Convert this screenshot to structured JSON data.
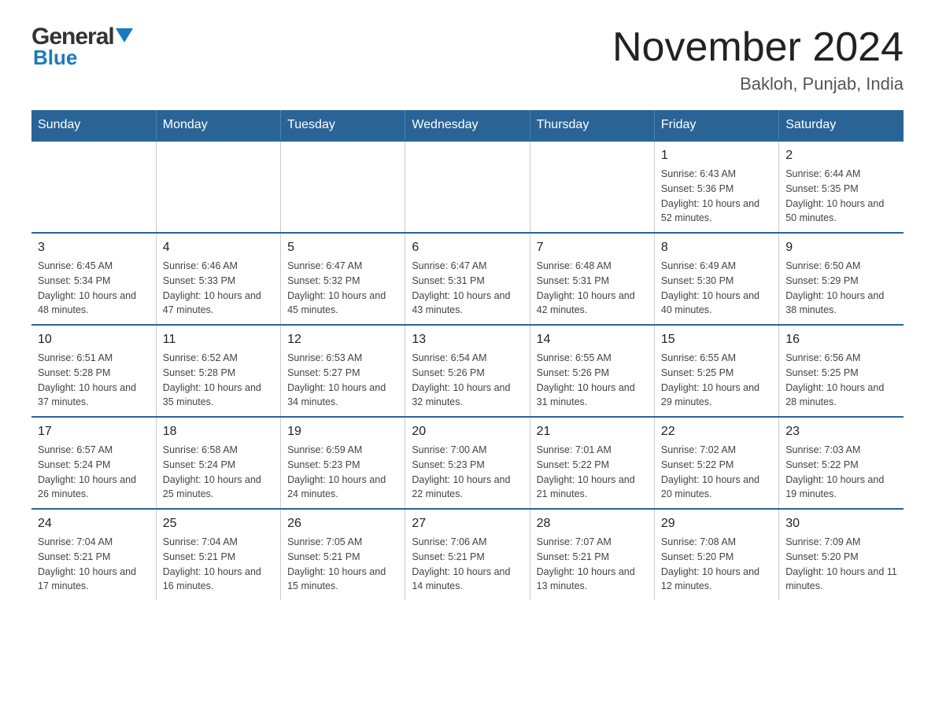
{
  "header": {
    "logo_general": "General",
    "logo_blue": "Blue",
    "title": "November 2024",
    "subtitle": "Bakloh, Punjab, India"
  },
  "calendar": {
    "weekdays": [
      "Sunday",
      "Monday",
      "Tuesday",
      "Wednesday",
      "Thursday",
      "Friday",
      "Saturday"
    ],
    "weeks": [
      [
        {
          "day": "",
          "info": ""
        },
        {
          "day": "",
          "info": ""
        },
        {
          "day": "",
          "info": ""
        },
        {
          "day": "",
          "info": ""
        },
        {
          "day": "",
          "info": ""
        },
        {
          "day": "1",
          "info": "Sunrise: 6:43 AM\nSunset: 5:36 PM\nDaylight: 10 hours and 52 minutes."
        },
        {
          "day": "2",
          "info": "Sunrise: 6:44 AM\nSunset: 5:35 PM\nDaylight: 10 hours and 50 minutes."
        }
      ],
      [
        {
          "day": "3",
          "info": "Sunrise: 6:45 AM\nSunset: 5:34 PM\nDaylight: 10 hours and 48 minutes."
        },
        {
          "day": "4",
          "info": "Sunrise: 6:46 AM\nSunset: 5:33 PM\nDaylight: 10 hours and 47 minutes."
        },
        {
          "day": "5",
          "info": "Sunrise: 6:47 AM\nSunset: 5:32 PM\nDaylight: 10 hours and 45 minutes."
        },
        {
          "day": "6",
          "info": "Sunrise: 6:47 AM\nSunset: 5:31 PM\nDaylight: 10 hours and 43 minutes."
        },
        {
          "day": "7",
          "info": "Sunrise: 6:48 AM\nSunset: 5:31 PM\nDaylight: 10 hours and 42 minutes."
        },
        {
          "day": "8",
          "info": "Sunrise: 6:49 AM\nSunset: 5:30 PM\nDaylight: 10 hours and 40 minutes."
        },
        {
          "day": "9",
          "info": "Sunrise: 6:50 AM\nSunset: 5:29 PM\nDaylight: 10 hours and 38 minutes."
        }
      ],
      [
        {
          "day": "10",
          "info": "Sunrise: 6:51 AM\nSunset: 5:28 PM\nDaylight: 10 hours and 37 minutes."
        },
        {
          "day": "11",
          "info": "Sunrise: 6:52 AM\nSunset: 5:28 PM\nDaylight: 10 hours and 35 minutes."
        },
        {
          "day": "12",
          "info": "Sunrise: 6:53 AM\nSunset: 5:27 PM\nDaylight: 10 hours and 34 minutes."
        },
        {
          "day": "13",
          "info": "Sunrise: 6:54 AM\nSunset: 5:26 PM\nDaylight: 10 hours and 32 minutes."
        },
        {
          "day": "14",
          "info": "Sunrise: 6:55 AM\nSunset: 5:26 PM\nDaylight: 10 hours and 31 minutes."
        },
        {
          "day": "15",
          "info": "Sunrise: 6:55 AM\nSunset: 5:25 PM\nDaylight: 10 hours and 29 minutes."
        },
        {
          "day": "16",
          "info": "Sunrise: 6:56 AM\nSunset: 5:25 PM\nDaylight: 10 hours and 28 minutes."
        }
      ],
      [
        {
          "day": "17",
          "info": "Sunrise: 6:57 AM\nSunset: 5:24 PM\nDaylight: 10 hours and 26 minutes."
        },
        {
          "day": "18",
          "info": "Sunrise: 6:58 AM\nSunset: 5:24 PM\nDaylight: 10 hours and 25 minutes."
        },
        {
          "day": "19",
          "info": "Sunrise: 6:59 AM\nSunset: 5:23 PM\nDaylight: 10 hours and 24 minutes."
        },
        {
          "day": "20",
          "info": "Sunrise: 7:00 AM\nSunset: 5:23 PM\nDaylight: 10 hours and 22 minutes."
        },
        {
          "day": "21",
          "info": "Sunrise: 7:01 AM\nSunset: 5:22 PM\nDaylight: 10 hours and 21 minutes."
        },
        {
          "day": "22",
          "info": "Sunrise: 7:02 AM\nSunset: 5:22 PM\nDaylight: 10 hours and 20 minutes."
        },
        {
          "day": "23",
          "info": "Sunrise: 7:03 AM\nSunset: 5:22 PM\nDaylight: 10 hours and 19 minutes."
        }
      ],
      [
        {
          "day": "24",
          "info": "Sunrise: 7:04 AM\nSunset: 5:21 PM\nDaylight: 10 hours and 17 minutes."
        },
        {
          "day": "25",
          "info": "Sunrise: 7:04 AM\nSunset: 5:21 PM\nDaylight: 10 hours and 16 minutes."
        },
        {
          "day": "26",
          "info": "Sunrise: 7:05 AM\nSunset: 5:21 PM\nDaylight: 10 hours and 15 minutes."
        },
        {
          "day": "27",
          "info": "Sunrise: 7:06 AM\nSunset: 5:21 PM\nDaylight: 10 hours and 14 minutes."
        },
        {
          "day": "28",
          "info": "Sunrise: 7:07 AM\nSunset: 5:21 PM\nDaylight: 10 hours and 13 minutes."
        },
        {
          "day": "29",
          "info": "Sunrise: 7:08 AM\nSunset: 5:20 PM\nDaylight: 10 hours and 12 minutes."
        },
        {
          "day": "30",
          "info": "Sunrise: 7:09 AM\nSunset: 5:20 PM\nDaylight: 10 hours and 11 minutes."
        }
      ]
    ]
  }
}
